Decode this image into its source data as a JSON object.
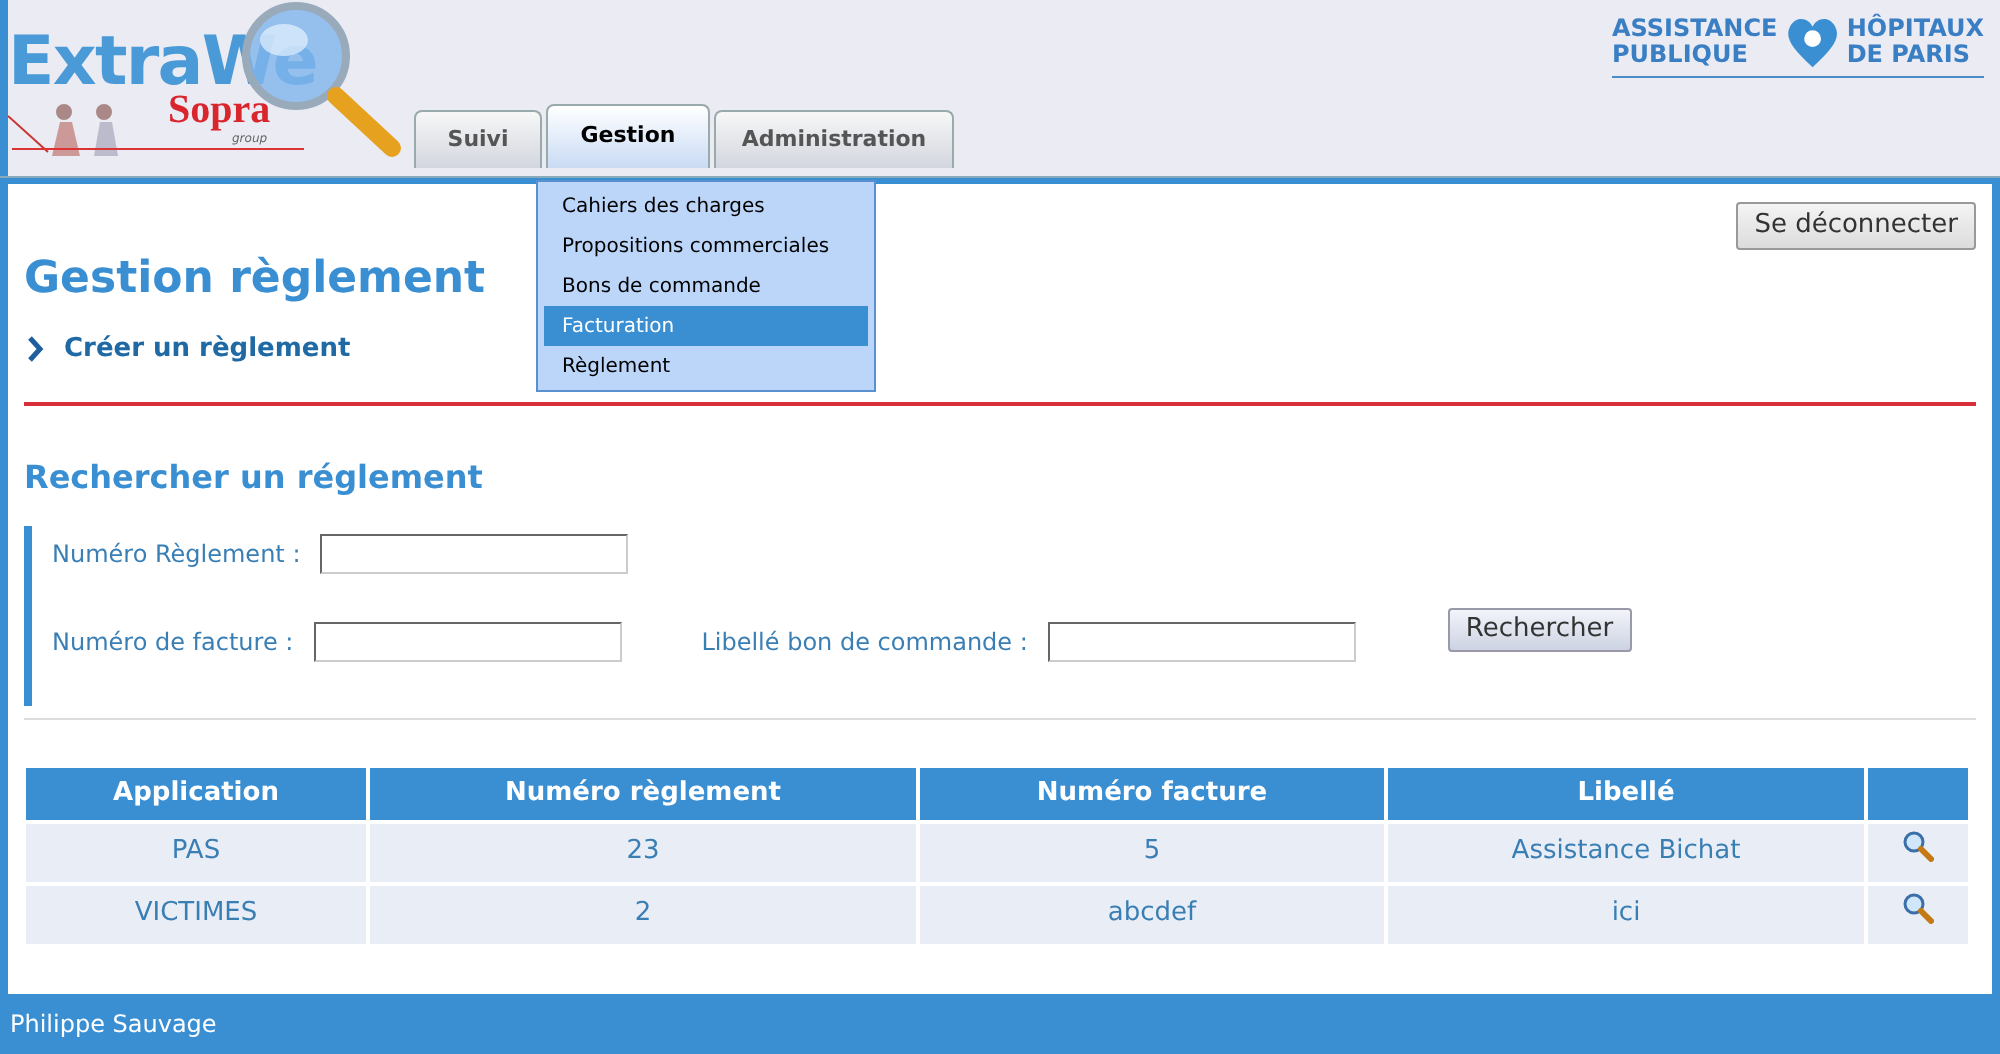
{
  "logo": {
    "word": "ExtraWe",
    "brand": "Sopra",
    "tagline": "group"
  },
  "partner_logo": {
    "line_1_left": "ASSISTANCE",
    "line_2_left": "PUBLIQUE",
    "line_1_right": "HÔPITAUX",
    "line_2_right": "DE PARIS"
  },
  "tabs": [
    {
      "label": "Suivi",
      "selected": false
    },
    {
      "label": "Gestion",
      "selected": true
    },
    {
      "label": "Administration",
      "selected": false
    }
  ],
  "menu": [
    {
      "label": "Cahiers des charges",
      "selected": false
    },
    {
      "label": "Propositions commerciales",
      "selected": false
    },
    {
      "label": "Bons de commande",
      "selected": false
    },
    {
      "label": "Facturation",
      "selected": true
    },
    {
      "label": "Règlement",
      "selected": false
    }
  ],
  "logout_button": "Se déconnecter",
  "page_title": "Gestion règlement",
  "create_link": "Créer un règlement",
  "search": {
    "title": "Rechercher un réglement",
    "fields": [
      {
        "label": "Numéro Règlement :"
      },
      {
        "label": "Numéro de facture :"
      },
      {
        "label": "Libellé bon de commande :"
      }
    ],
    "button": "Rechercher"
  },
  "table": {
    "columns": [
      "Application",
      "Numéro règlement",
      "Numéro facture",
      "Libellé"
    ],
    "rows": [
      [
        "PAS",
        "23",
        "5",
        "Assistance Bichat"
      ],
      [
        "VICTIMES",
        "2",
        "abcdef",
        "ici"
      ]
    ]
  },
  "footer": "Philippe Sauvage"
}
